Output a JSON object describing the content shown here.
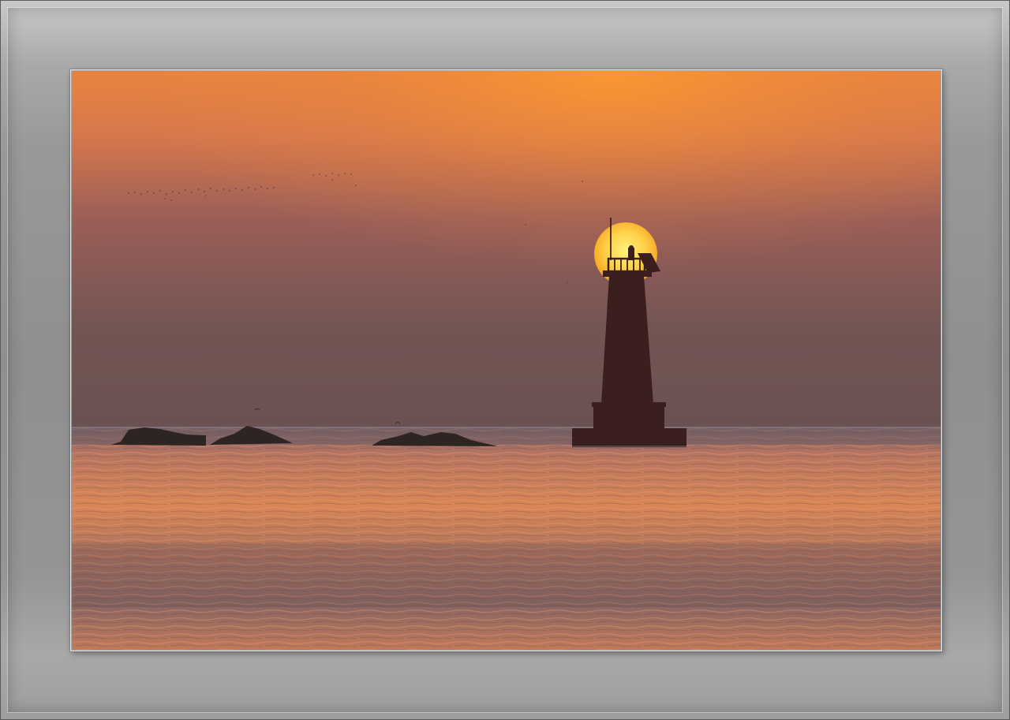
{
  "photo": {
    "subject": "lighthouse-at-sunset",
    "colors": {
      "sky_top": "#f08a3a",
      "sky_mid": "#b8655a",
      "sky_bottom": "#6b5151",
      "sun_core": "#ffe46a",
      "sun_edge": "#f6a21e",
      "sea_highlight": "#e8925a",
      "sea_shadow": "#5e4d52",
      "silhouette": "#3a1f1e",
      "frame_gray": "#8f8f8f"
    }
  }
}
